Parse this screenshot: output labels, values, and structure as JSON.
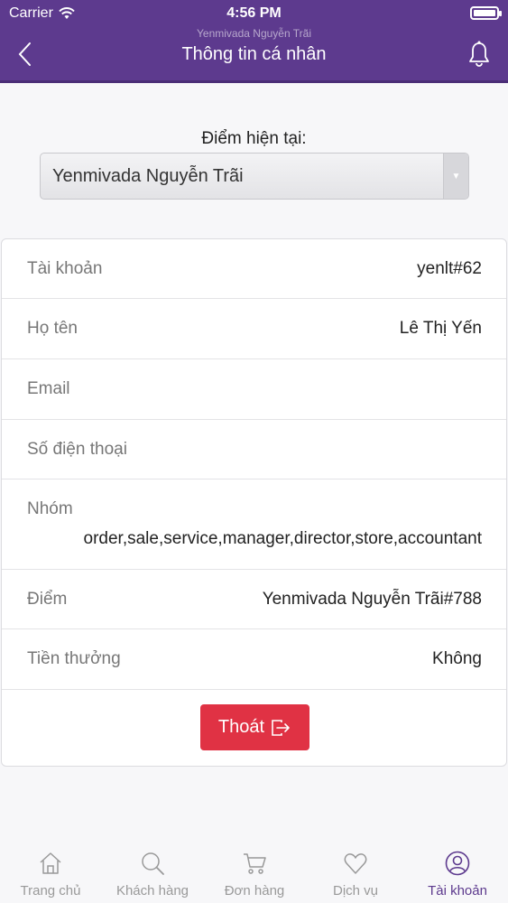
{
  "status_bar": {
    "carrier": "Carrier",
    "time": "4:56 PM"
  },
  "header": {
    "subtitle": "Yenmivada Nguyễn Trãi",
    "title": "Thông tin cá nhân",
    "back_icon": "chevron-left-icon",
    "bell_icon": "bell-icon",
    "color": "#5d3a8e"
  },
  "store_picker": {
    "label": "Điểm hiện tại:",
    "selected": "Yenmivada Nguyễn Trãi"
  },
  "profile": {
    "rows": [
      {
        "label": "Tài khoản",
        "value": "yenlt#62"
      },
      {
        "label": "Họ tên",
        "value": "Lê Thị Yến"
      },
      {
        "label": "Email",
        "value": ""
      },
      {
        "label": "Số điện thoại",
        "value": ""
      },
      {
        "label": "Nhóm",
        "value": "order,sale,service,manager,director,store,accountant"
      },
      {
        "label": "Điểm",
        "value": "Yenmivada Nguyễn Trãi#788"
      },
      {
        "label": "Tiền thưởng",
        "value": "Không"
      }
    ],
    "logout_label": "Thoát",
    "logout_color": "#e03244"
  },
  "tabs": [
    {
      "label": "Trang chủ",
      "icon": "home-icon",
      "active": false
    },
    {
      "label": "Khách hàng",
      "icon": "search-icon",
      "active": false
    },
    {
      "label": "Đơn hàng",
      "icon": "cart-icon",
      "active": false
    },
    {
      "label": "Dịch vụ",
      "icon": "heart-icon",
      "active": false
    },
    {
      "label": "Tài khoản",
      "icon": "user-icon",
      "active": true
    }
  ]
}
